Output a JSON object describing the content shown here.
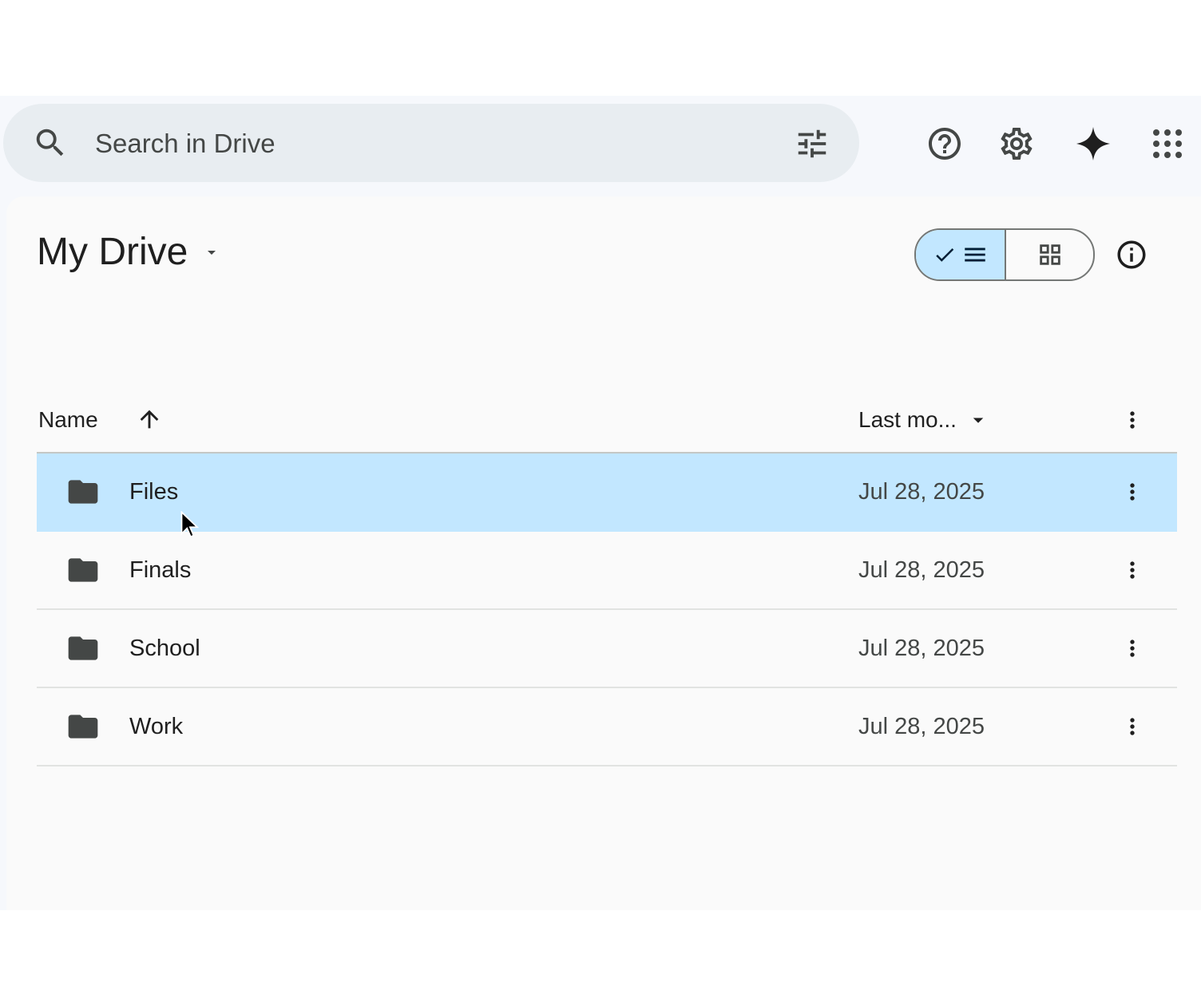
{
  "header": {
    "search_placeholder": "Search in Drive",
    "icons": [
      "search-icon",
      "tune-icon",
      "help-icon",
      "settings-icon",
      "gemini-spark-icon",
      "apps-grid-icon"
    ]
  },
  "page": {
    "title": "My Drive",
    "view_mode": "list"
  },
  "table": {
    "columns": {
      "name": "Name",
      "last_modified": "Last mo..."
    },
    "sort": {
      "column": "name",
      "direction": "ascending"
    },
    "rows": [
      {
        "name": "Files",
        "modified": "Jul 28, 2025",
        "type": "folder",
        "selected": true
      },
      {
        "name": "Finals",
        "modified": "Jul 28, 2025",
        "type": "folder",
        "selected": false
      },
      {
        "name": "School",
        "modified": "Jul 28, 2025",
        "type": "folder",
        "selected": false
      },
      {
        "name": "Work",
        "modified": "Jul 28, 2025",
        "type": "folder",
        "selected": false
      }
    ]
  },
  "colors": {
    "selected_row": "#c2e7ff",
    "search_bg": "#e8edf1",
    "app_bg": "#f6f8fc",
    "icon": "#444746"
  }
}
